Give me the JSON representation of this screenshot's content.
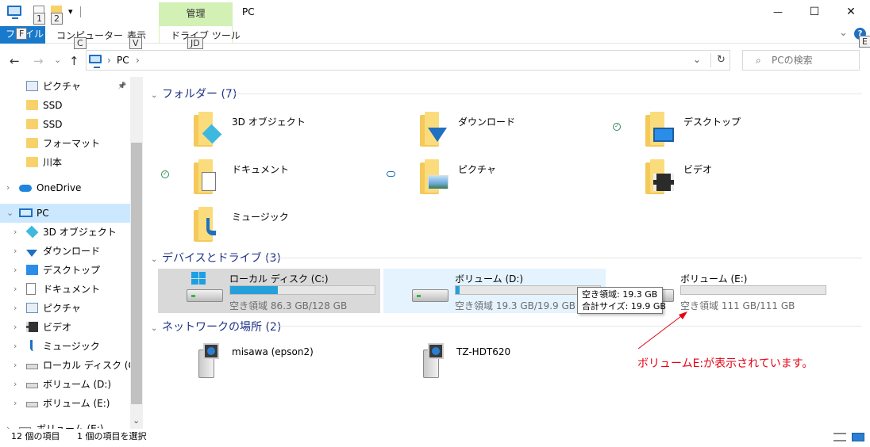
{
  "titlebar": {
    "title": "PC",
    "manage_tab": "管理",
    "minimize": "—",
    "maximize": "☐",
    "close": "✕",
    "qat_dropdown": "▾",
    "keytips": {
      "qat1": "1",
      "qat2": "2"
    }
  },
  "ribbon": {
    "file": "ファイル",
    "computer": "コンピューター",
    "view": "表示",
    "drive_tools": "ドライブ ツール",
    "expand": "⌄",
    "help": "?",
    "keytips": {
      "file": "F",
      "computer": "C",
      "view": "V",
      "drive_tools": "JD",
      "help": "E"
    }
  },
  "addressbar": {
    "back": "←",
    "forward": "→",
    "recent": "⌄",
    "up": "↑",
    "crumb_root_sep": "›",
    "crumb": "PC",
    "crumb_sep": "›",
    "dropdown": "⌄",
    "refresh": "↻",
    "search_placeholder": "PCの検索",
    "search_icon": "⌕"
  },
  "navpane": {
    "items": [
      {
        "label": "ピクチャ",
        "icon": "pictures-icon"
      },
      {
        "label": "SSD",
        "icon": "folder-icon"
      },
      {
        "label": "SSD",
        "icon": "folder-icon"
      },
      {
        "label": "フォーマット",
        "icon": "folder-icon"
      },
      {
        "label": "川本",
        "icon": "folder-icon"
      },
      {
        "label": "OneDrive",
        "icon": "onedrive-icon"
      },
      {
        "label": "PC",
        "icon": "pc-icon"
      },
      {
        "label": "3D オブジェクト",
        "icon": "3d-objects-icon"
      },
      {
        "label": "ダウンロード",
        "icon": "downloads-icon"
      },
      {
        "label": "デスクトップ",
        "icon": "desktop-icon"
      },
      {
        "label": "ドキュメント",
        "icon": "documents-icon"
      },
      {
        "label": "ピクチャ",
        "icon": "pictures-icon"
      },
      {
        "label": "ビデオ",
        "icon": "videos-icon"
      },
      {
        "label": "ミュージック",
        "icon": "music-icon"
      },
      {
        "label": "ローカル ディスク (C:)",
        "icon": "local-disk-icon"
      },
      {
        "label": "ボリューム (D:)",
        "icon": "drive-icon"
      },
      {
        "label": "ボリューム (E:)",
        "icon": "drive-icon"
      },
      {
        "label": "ボリューム (E:)",
        "icon": "drive-icon"
      }
    ],
    "pin": "📌",
    "chevron_right": "›",
    "chevron_down": "⌄",
    "scroll_down": "⌄"
  },
  "content": {
    "folders_header": "フォルダー (7)",
    "folders": [
      {
        "name": "3D オブジェクト",
        "icon": "3d-objects-folder-icon"
      },
      {
        "name": "ダウンロード",
        "icon": "downloads-folder-icon"
      },
      {
        "name": "デスクトップ",
        "icon": "desktop-folder-icon",
        "sync": "check"
      },
      {
        "name": "ドキュメント",
        "icon": "documents-folder-icon",
        "sync": "check"
      },
      {
        "name": "ピクチャ",
        "icon": "pictures-folder-icon",
        "sync": "cloud"
      },
      {
        "name": "ビデオ",
        "icon": "videos-folder-icon"
      },
      {
        "name": "ミュージック",
        "icon": "music-folder-icon"
      }
    ],
    "drives_header": "デバイスとドライブ (3)",
    "drives": [
      {
        "name": "ローカル ディスク (C:)",
        "free_text": "空き領域 86.3 GB/128 GB",
        "used_fraction": 0.33
      },
      {
        "name": "ボリューム (D:)",
        "free_text": "空き領域 19.3 GB/19.9 GB",
        "used_fraction": 0.03
      },
      {
        "name": "ボリューム (E:)",
        "free_text": "空き領域 111 GB/111 GB",
        "used_fraction": 0.0
      }
    ],
    "network_header": "ネットワークの場所 (2)",
    "network": [
      {
        "name": "misawa (epson2)",
        "icon": "media-server-icon"
      },
      {
        "name": "TZ-HDT620",
        "icon": "media-server-icon"
      }
    ],
    "tooltip": {
      "line1": "空き領域: 19.3 GB",
      "line2": "合計サイズ: 19.9 GB"
    },
    "group_chevron": "⌄",
    "annotation": "ボリュームE:が表示されています。",
    "annotation_color": "#e60012"
  },
  "statusbar": {
    "count": "12 個の項目",
    "selected": "1 個の項目を選択"
  },
  "colors": {
    "accent": "#1979ca",
    "manage": "#d4f1b5",
    "selection": "#cce8ff",
    "header_text": "#1e3287",
    "bar_fill": "#26a0da"
  }
}
